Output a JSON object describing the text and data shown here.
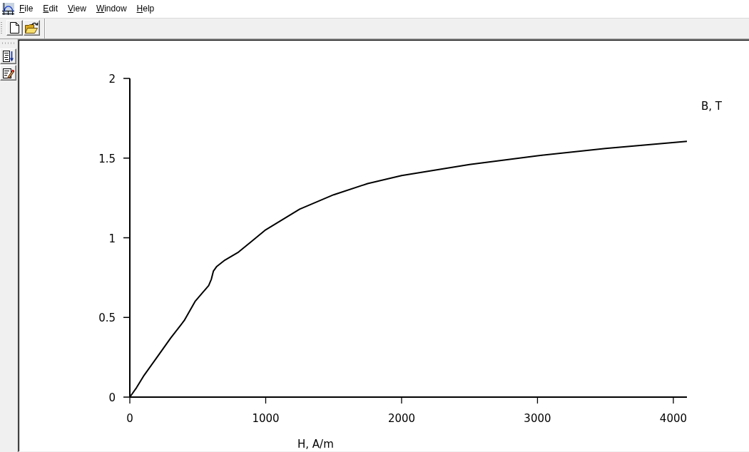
{
  "menu_bar": {
    "items": [
      "File",
      "Edit",
      "View",
      "Window",
      "Help"
    ]
  },
  "toolbar": {
    "buttons": [
      {
        "kind": "new"
      },
      {
        "kind": "open"
      }
    ]
  },
  "side_toolbar": {
    "buttons": [
      {
        "kind": "sort"
      },
      {
        "kind": "edit"
      }
    ]
  },
  "plot": {
    "chart_data": {
      "type": "line",
      "xlabel": "H, A/m",
      "ylabel": "B, T",
      "x": [
        0,
        50,
        100,
        200,
        300,
        400,
        480,
        530,
        580,
        600,
        615,
        640,
        700,
        800,
        900,
        1000,
        1250,
        1500,
        1750,
        2000,
        2500,
        3000,
        3500,
        4100
      ],
      "values": [
        0,
        0.06,
        0.13,
        0.25,
        0.37,
        0.48,
        0.6,
        0.65,
        0.7,
        0.74,
        0.79,
        0.82,
        0.86,
        0.91,
        0.98,
        1.05,
        1.18,
        1.27,
        1.34,
        1.39,
        1.46,
        1.515,
        1.56,
        1.605
      ],
      "xlim": [
        0,
        4100
      ],
      "ylim": [
        0,
        2
      ],
      "xticks": [
        0,
        1000,
        2000,
        3000,
        4000
      ],
      "yticks": [
        0,
        0.5,
        1,
        1.5,
        2
      ]
    }
  }
}
